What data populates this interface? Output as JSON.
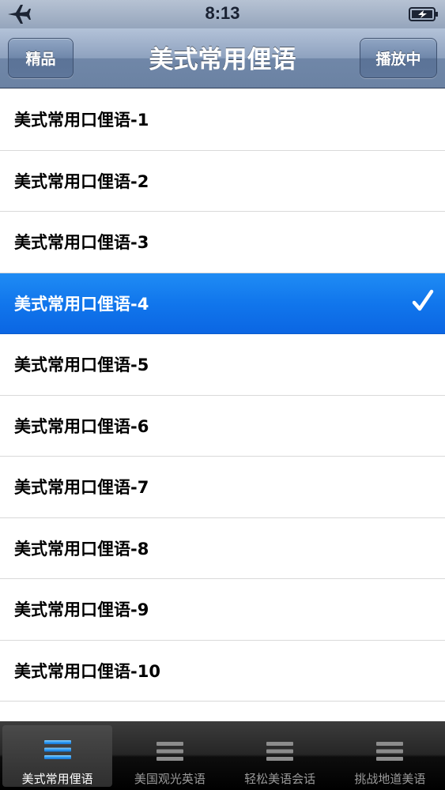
{
  "status_bar": {
    "time": "8:13",
    "icons": [
      "airplane-icon",
      "battery-charging-icon"
    ]
  },
  "nav_bar": {
    "left_button": "精品",
    "title": "美式常用俚语",
    "right_button": "播放中"
  },
  "list": {
    "items": [
      "美式常用口俚语-1",
      "美式常用口俚语-2",
      "美式常用口俚语-3",
      "美式常用口俚语-4",
      "美式常用口俚语-5",
      "美式常用口俚语-6",
      "美式常用口俚语-7",
      "美式常用口俚语-8",
      "美式常用口俚语-9",
      "美式常用口俚语-10"
    ],
    "selected_index": 3,
    "selected_accessory_icon": "checkmark-icon"
  },
  "tab_bar": {
    "tabs": [
      {
        "label": "美式常用俚语",
        "icon": "list-icon",
        "active": true
      },
      {
        "label": "美国观光英语",
        "icon": "list-icon",
        "active": false
      },
      {
        "label": "轻松美语会话",
        "icon": "list-icon",
        "active": false
      },
      {
        "label": "挑战地道美语",
        "icon": "list-icon",
        "active": false
      }
    ]
  },
  "colors": {
    "selection_blue": "#1176ec",
    "nav_blue": "#7087a8",
    "tab_bar_black": "#000000"
  }
}
